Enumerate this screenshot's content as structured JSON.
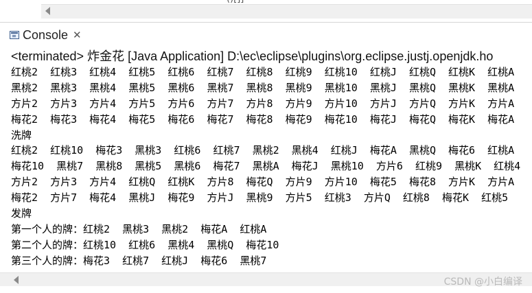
{
  "top": {
    "clipped_text": "()[]]"
  },
  "tab": {
    "label": "Console",
    "close_glyph": "✕",
    "icon": "console-icon"
  },
  "console": {
    "status": "<terminated> 炸金花 [Java Application] D:\\ec\\eclipse\\plugins\\org.eclipse.justj.openjdk.ho",
    "lines": [
      "红桃2  红桃3  红桃4  红桃5  红桃6  红桃7  红桃8  红桃9  红桃10  红桃J  红桃Q  红桃K  红桃A",
      "黑桃2  黑桃3  黑桃4  黑桃5  黑桃6  黑桃7  黑桃8  黑桃9  黑桃10  黑桃J  黑桃Q  黑桃K  黑桃A",
      "方片2  方片3  方片4  方片5  方片6  方片7  方片8  方片9  方片10  方片J  方片Q  方片K  方片A",
      "梅花2  梅花3  梅花4  梅花5  梅花6  梅花7  梅花8  梅花9  梅花10  梅花J  梅花Q  梅花K  梅花A",
      "洗牌",
      "红桃2  红桃10  梅花3  黑桃3  红桃6  红桃7  黑桃2  黑桃4  红桃J  梅花A  黑桃Q  梅花6  红桃A",
      "梅花10  黑桃7  黑桃8  黑桃5  黑桃6  梅花7  黑桃A  梅花J  黑桃10  方片6  红桃9  黑桃K  红桃4",
      "方片2  方片3  方片4  红桃Q  红桃K  方片8  梅花Q  方片9  方片10  梅花5  梅花8  方片K  方片A",
      "梅花2  方片7  梅花4  黑桃J  梅花9  方片J  黑桃9  方片5  红桃3  方片Q  红桃8  梅花K  红桃5",
      "发牌",
      "第一个人的牌：红桃2  黑桃3  黑桃2  梅花A  红桃A",
      "第二个人的牌：红桃10  红桃6  黑桃4  黑桃Q  梅花10",
      "第三个人的牌：梅花3  红桃7  红桃J  梅花6  黑桃7"
    ]
  },
  "watermark": "CSDN @小白编译"
}
